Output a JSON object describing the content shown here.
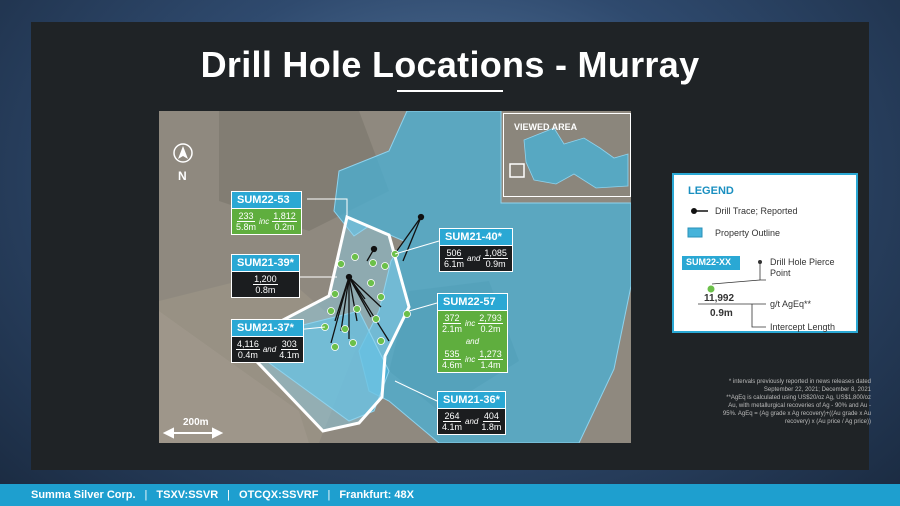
{
  "title": "Drill Hole Locations - Murray",
  "map": {
    "north_label": "N",
    "scale_label": "200m",
    "inset_title": "VIEWED AREA",
    "property_color": "#46b3da",
    "pierce_color": "#6cc04a",
    "holes": {
      "sum22_53": {
        "name": "SUM22-53",
        "v1": "233",
        "l1": "5.8m",
        "conj": "inc",
        "v2": "1,812",
        "l2": "0.2m"
      },
      "sum21_40": {
        "name": "SUM21-40*",
        "v1": "506",
        "l1": "6.1m",
        "conj": "and",
        "v2": "1,085",
        "l2": "0.9m"
      },
      "sum21_39": {
        "name": "SUM21-39*",
        "v1": "1,200",
        "l1": "0.8m"
      },
      "sum22_57": {
        "name": "SUM22-57",
        "v1": "372",
        "l1": "2.1m",
        "conj1": "inc",
        "v2": "2,793",
        "l2": "0.2m",
        "and": "and",
        "v3": "535",
        "l3": "4.6m",
        "conj2": "inc",
        "v4": "1,273",
        "l4": "1.4m"
      },
      "sum21_37": {
        "name": "SUM21-37*",
        "v1": "4,116",
        "l1": "0.4m",
        "conj": "and",
        "v2": "303",
        "l2": "4.1m"
      },
      "sum21_36": {
        "name": "SUM21-36*",
        "v1": "264",
        "l1": "4.1m",
        "conj": "and",
        "v2": "404",
        "l2": "1.8m"
      }
    }
  },
  "legend": {
    "title": "LEGEND",
    "drill_trace": "Drill Trace; Reported",
    "property_outline": "Property Outline",
    "example_name": "SUM22-XX",
    "pierce_point": "Drill Hole Pierce Point",
    "example_value": "11,992",
    "example_length": "0.9m",
    "grade_label": "g/t AgEq**",
    "length_label": "Intercept Length"
  },
  "notes": [
    "* intervals previously reported in news releases dated",
    "September 22, 2021; December 8, 2021",
    "**AgEq is calculated using US$20/oz Ag, US$1,800/oz",
    "Au, with metallurgical recoveries of Ag - 90% and Au -",
    "95%. AgEq = (Ag grade x Ag recovery)+((Au grade x Au",
    "recovery) x (Au price / Ag price))"
  ],
  "footer": {
    "company": "Summa Silver Corp.",
    "tsxv": "TSXV:SSVR",
    "otcqx": "OTCQX:SSVRF",
    "frankfurt": "Frankfurt: 48X",
    "separator": "|"
  }
}
